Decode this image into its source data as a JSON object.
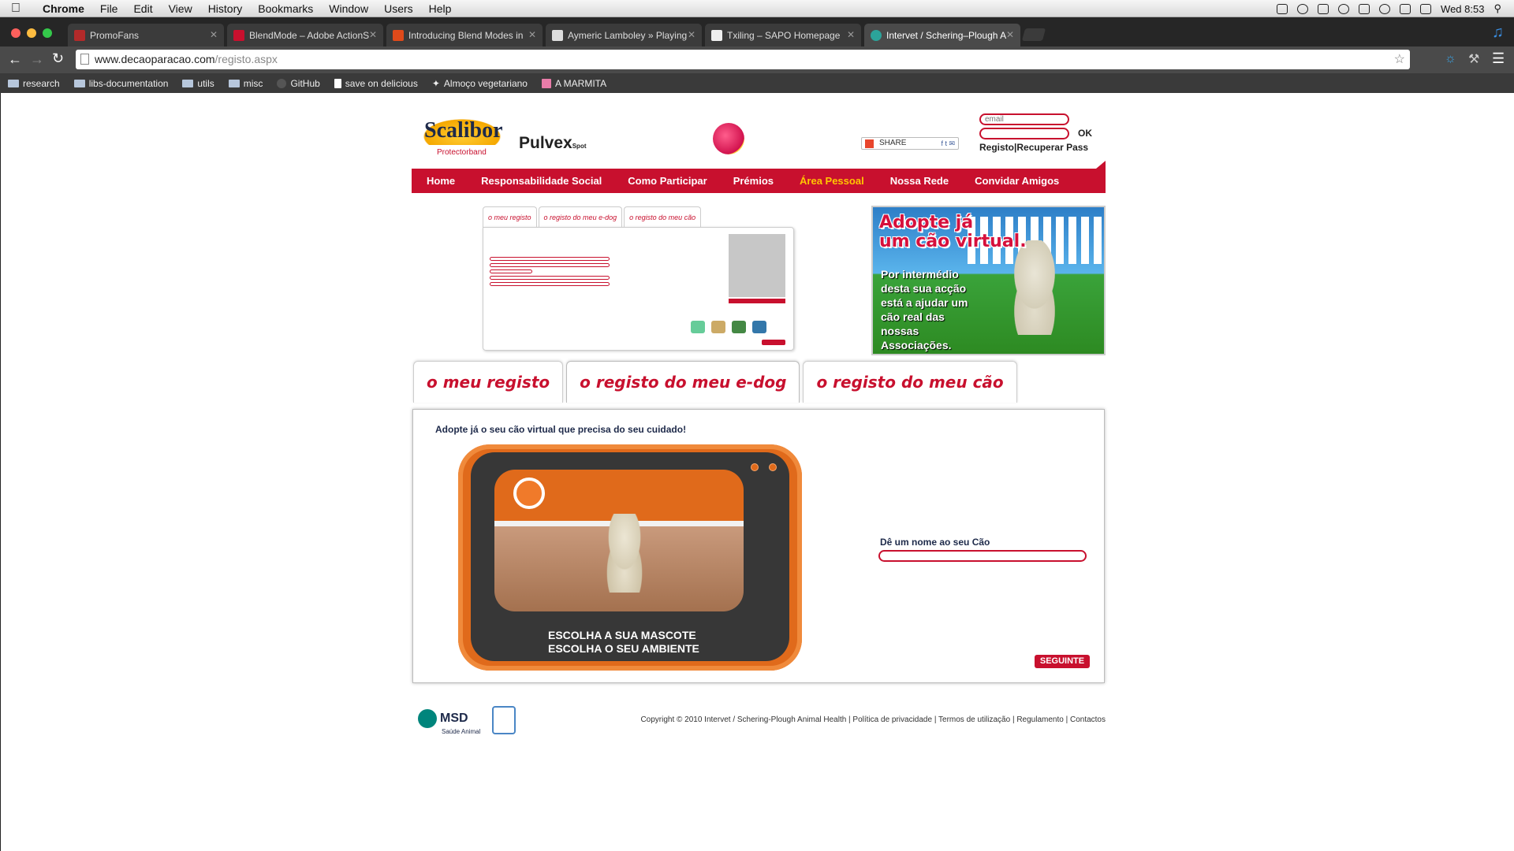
{
  "menubar": {
    "app": "Chrome",
    "items": [
      "File",
      "Edit",
      "View",
      "History",
      "Bookmarks",
      "Window",
      "Users",
      "Help"
    ],
    "clock": "Wed 8:53"
  },
  "tabs": [
    {
      "label": "PromoFans",
      "color": "#b32a2a"
    },
    {
      "label": "BlendMode – Adobe ActionS",
      "color": "#c8102e"
    },
    {
      "label": "Introducing Blend Modes in",
      "color": "#e04a1a"
    },
    {
      "label": "Aymeric Lamboley » Playing",
      "color": "#444444"
    },
    {
      "label": "Txiling – SAPO Homepage",
      "color": "#dddddd"
    },
    {
      "label": "Intervet / Schering–Plough A",
      "color": "#2ca39a"
    }
  ],
  "address": {
    "host": "www.decaoparacao.com",
    "path": "/registo.aspx"
  },
  "bookmarks": [
    "research",
    "libs-documentation",
    "utils",
    "misc",
    "GitHub",
    "save on delicious",
    "Almoço vegetariano",
    "A MARMITA"
  ],
  "header": {
    "logo_main": "Scalibor",
    "logo_sub": "Protectorband",
    "logo2": "Pulvex",
    "logo2_small": "Spot",
    "share": "SHARE",
    "email_placeholder": "email",
    "ok": "OK",
    "register": "Registo",
    "recover": "Recuperar Pass"
  },
  "nav": [
    "Home",
    "Responsabilidade Social",
    "Como Participar",
    "Prémios",
    "Área Pessoal",
    "Nossa Rede",
    "Convidar Amigos"
  ],
  "mini_tabs": [
    "o meu registo",
    "o registo do meu e-dog",
    "o registo do meu cão"
  ],
  "ad": {
    "headline1": "Adopte já",
    "headline2": "um cão virtual.",
    "text": "Por intermédio desta sua acção está a ajudar um cão real das nossas Associações."
  },
  "big_tabs": [
    "o meu registo",
    "o registo do meu e-dog",
    "o registo do meu cão"
  ],
  "panel": {
    "title": "Adopte já o seu cão virtual que precisa do seu cuidado!",
    "caption1": "ESCOLHA A SUA MASCOTE",
    "caption2": "ESCOLHA O SEU AMBIENTE",
    "name_label": "Dê um nome ao seu Cão",
    "next": "SEGUINTE"
  },
  "footer": {
    "msd": "MSD",
    "msd_sub": "Saúde Animal",
    "copyright": "Copyright © 2010 Intervet / Schering-Plough Animal Health | Política de privacidade | Termos de utilização | Regulamento | Contactos"
  },
  "colors": {
    "brand_red": "#c8102e",
    "nav_active": "#ffc600",
    "tv_orange": "#e06a1b"
  }
}
